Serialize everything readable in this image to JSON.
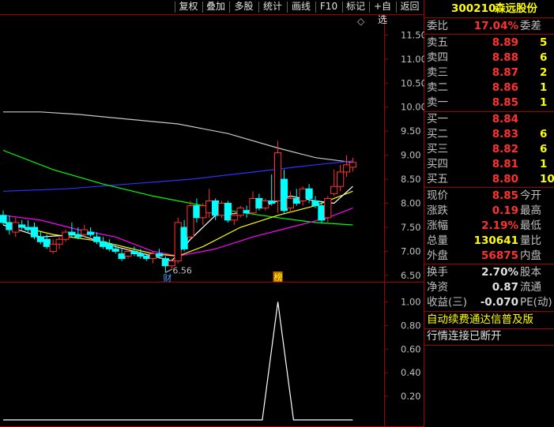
{
  "toolbar": {
    "items": [
      "复权",
      "叠加",
      "多股",
      "统计",
      "画线",
      "F10",
      "标记",
      "+自选",
      "返回"
    ]
  },
  "stock": {
    "code": "300210",
    "name": "森远股份"
  },
  "colors": {
    "up": "#ff3232",
    "down": "#00ffff",
    "ma5": "#ffffff",
    "ma10": "#ffff00",
    "ma20": "#ff00ff",
    "ma60": "#00ff00",
    "ma120": "#3030ff",
    "ma250": "#c8c8c8",
    "grid": "#a00000"
  },
  "order_book": {
    "wei_bi_label": "委比",
    "wei_bi_value": "17.04%",
    "wei_cha_label": "委差",
    "asks": [
      {
        "label": "卖五",
        "price": "8.89",
        "vol": "5"
      },
      {
        "label": "卖四",
        "price": "8.88",
        "vol": "6"
      },
      {
        "label": "卖三",
        "price": "8.87",
        "vol": "2"
      },
      {
        "label": "卖二",
        "price": "8.86",
        "vol": "1"
      },
      {
        "label": "卖一",
        "price": "8.85",
        "vol": "1"
      }
    ],
    "bids": [
      {
        "label": "买一",
        "price": "8.84",
        "vol": ""
      },
      {
        "label": "买二",
        "price": "8.83",
        "vol": "6"
      },
      {
        "label": "买三",
        "price": "8.82",
        "vol": "6"
      },
      {
        "label": "买四",
        "price": "8.81",
        "vol": "1"
      },
      {
        "label": "买五",
        "price": "8.80",
        "vol": "10"
      }
    ]
  },
  "quote": {
    "rows": [
      {
        "label": "现价",
        "value": "8.85",
        "label2": "今开"
      },
      {
        "label": "涨跌",
        "value": "0.19",
        "label2": "最高"
      },
      {
        "label": "涨幅",
        "value": "2.19%",
        "label2": "最低"
      },
      {
        "label": "总量",
        "value": "130641",
        "label2": "量比"
      },
      {
        "label": "外盘",
        "value": "56875",
        "label2": "内盘"
      }
    ]
  },
  "fundamentals": {
    "rows": [
      {
        "label": "换手",
        "value": "2.70%",
        "label2": "股本"
      },
      {
        "label": "净资",
        "value": "0.87",
        "label2": "流通"
      },
      {
        "label": "收益(三)",
        "value": "-0.070",
        "label2": "PE(动)"
      }
    ]
  },
  "messages": {
    "ad": "自动续费通达信普及版",
    "status": "行情连接已断开"
  },
  "chart_data": [
    {
      "type": "candlestick",
      "title": "",
      "y_ticks": [
        "11.50",
        "11.00",
        "10.50",
        "10.00",
        "9.50",
        "9.00",
        "8.50",
        "8.00",
        "7.50",
        "7.00",
        "6.50"
      ],
      "ylim": [
        6.4,
        11.9
      ],
      "annotations": [
        {
          "text": "6.56",
          "x_index": 26,
          "y": 6.56
        },
        {
          "text": "财",
          "x_index": 26
        },
        {
          "text": "榜",
          "x_index": 44
        }
      ],
      "diamond": "◇",
      "ohlc": [
        [
          7.75,
          7.85,
          7.55,
          7.6
        ],
        [
          7.6,
          7.75,
          7.35,
          7.45
        ],
        [
          7.4,
          7.7,
          7.3,
          7.6
        ],
        [
          7.55,
          7.65,
          7.45,
          7.5
        ],
        [
          7.5,
          7.65,
          7.4,
          7.45
        ],
        [
          7.5,
          7.6,
          7.25,
          7.3
        ],
        [
          7.3,
          7.4,
          7.15,
          7.2
        ],
        [
          7.25,
          7.35,
          7.05,
          7.1
        ],
        [
          7.0,
          7.25,
          6.95,
          7.15
        ],
        [
          7.15,
          7.3,
          7.05,
          7.25
        ],
        [
          7.25,
          7.45,
          7.2,
          7.4
        ],
        [
          7.4,
          7.6,
          7.3,
          7.35
        ],
        [
          7.35,
          7.5,
          7.25,
          7.3
        ],
        [
          7.35,
          7.55,
          7.3,
          7.45
        ],
        [
          7.4,
          7.5,
          7.3,
          7.35
        ],
        [
          7.3,
          7.4,
          7.15,
          7.2
        ],
        [
          7.2,
          7.3,
          7.05,
          7.1
        ],
        [
          7.15,
          7.25,
          7.0,
          7.05
        ],
        [
          7.05,
          7.15,
          6.95,
          7.0
        ],
        [
          6.95,
          7.05,
          6.8,
          6.85
        ],
        [
          6.9,
          7.05,
          6.85,
          7.0
        ],
        [
          7.0,
          7.1,
          6.9,
          6.95
        ],
        [
          6.95,
          7.05,
          6.85,
          6.9
        ],
        [
          6.9,
          6.95,
          6.8,
          6.85
        ],
        [
          6.85,
          7.0,
          6.75,
          6.95
        ],
        [
          6.95,
          7.05,
          6.85,
          6.9
        ],
        [
          6.85,
          6.9,
          6.56,
          6.7
        ],
        [
          6.7,
          6.85,
          6.62,
          6.8
        ],
        [
          6.8,
          7.7,
          6.75,
          7.6
        ],
        [
          7.5,
          7.65,
          7.0,
          7.05
        ],
        [
          7.3,
          8.05,
          7.25,
          7.95
        ],
        [
          7.95,
          8.1,
          7.6,
          7.7
        ],
        [
          7.7,
          8.0,
          7.55,
          7.95
        ],
        [
          7.8,
          8.3,
          7.7,
          8.05
        ],
        [
          8.05,
          8.1,
          7.65,
          7.75
        ],
        [
          7.75,
          8.05,
          7.7,
          8.0
        ],
        [
          8.0,
          8.05,
          7.6,
          7.65
        ],
        [
          7.65,
          7.8,
          7.55,
          7.75
        ],
        [
          7.75,
          7.95,
          7.7,
          7.9
        ],
        [
          7.85,
          7.95,
          7.7,
          7.8
        ],
        [
          7.8,
          8.25,
          7.75,
          8.1
        ],
        [
          8.1,
          8.2,
          7.85,
          7.9
        ],
        [
          7.9,
          8.1,
          7.85,
          8.05
        ],
        [
          8.05,
          8.6,
          7.95,
          8.0
        ],
        [
          8.05,
          9.3,
          7.8,
          9.05
        ],
        [
          8.5,
          8.7,
          7.8,
          7.85
        ],
        [
          7.9,
          8.25,
          7.8,
          8.1
        ],
        [
          8.1,
          8.3,
          7.95,
          8.0
        ],
        [
          8.05,
          8.35,
          7.95,
          8.3
        ],
        [
          8.3,
          8.4,
          8.0,
          8.1
        ],
        [
          8.05,
          8.15,
          7.9,
          7.95
        ],
        [
          7.95,
          8.05,
          7.6,
          7.65
        ],
        [
          7.7,
          8.15,
          7.6,
          8.1
        ],
        [
          8.2,
          8.7,
          8.15,
          8.35
        ],
        [
          8.35,
          8.8,
          8.25,
          8.65
        ],
        [
          8.65,
          9.0,
          8.55,
          8.8
        ],
        [
          8.75,
          8.95,
          8.66,
          8.85
        ]
      ],
      "ma_series": [
        {
          "key": "ma250",
          "values": [
            [
              0,
              9.9
            ],
            [
              6,
              9.9
            ],
            [
              12,
              9.85
            ],
            [
              20,
              9.75
            ],
            [
              28,
              9.65
            ],
            [
              36,
              9.45
            ],
            [
              44,
              9.15
            ],
            [
              50,
              8.95
            ],
            [
              56,
              8.85
            ]
          ]
        },
        {
          "key": "ma120",
          "values": [
            [
              0,
              8.25
            ],
            [
              10,
              8.3
            ],
            [
              20,
              8.4
            ],
            [
              30,
              8.5
            ],
            [
              40,
              8.65
            ],
            [
              50,
              8.8
            ],
            [
              56,
              8.88
            ]
          ]
        },
        {
          "key": "ma60",
          "values": [
            [
              0,
              9.1
            ],
            [
              8,
              8.7
            ],
            [
              16,
              8.4
            ],
            [
              24,
              8.15
            ],
            [
              30,
              8.0
            ],
            [
              36,
              7.85
            ],
            [
              44,
              7.7
            ],
            [
              50,
              7.6
            ],
            [
              56,
              7.55
            ]
          ]
        },
        {
          "key": "ma20",
          "values": [
            [
              0,
              7.75
            ],
            [
              6,
              7.65
            ],
            [
              12,
              7.45
            ],
            [
              18,
              7.3
            ],
            [
              24,
              7.0
            ],
            [
              28,
              6.9
            ],
            [
              34,
              7.05
            ],
            [
              40,
              7.3
            ],
            [
              46,
              7.5
            ],
            [
              52,
              7.7
            ],
            [
              56,
              7.9
            ]
          ]
        },
        {
          "key": "ma10",
          "values": [
            [
              0,
              7.6
            ],
            [
              8,
              7.35
            ],
            [
              16,
              7.2
            ],
            [
              24,
              6.95
            ],
            [
              28,
              6.9
            ],
            [
              32,
              7.1
            ],
            [
              38,
              7.5
            ],
            [
              44,
              7.75
            ],
            [
              50,
              7.95
            ],
            [
              56,
              8.25
            ]
          ]
        },
        {
          "key": "ma5",
          "values": [
            [
              0,
              7.55
            ],
            [
              6,
              7.3
            ],
            [
              12,
              7.35
            ],
            [
              18,
              7.1
            ],
            [
              24,
              6.9
            ],
            [
              27,
              6.8
            ],
            [
              30,
              7.25
            ],
            [
              34,
              7.75
            ],
            [
              38,
              7.8
            ],
            [
              42,
              7.95
            ],
            [
              46,
              8.15
            ],
            [
              50,
              8.05
            ],
            [
              53,
              8.0
            ],
            [
              56,
              8.35
            ]
          ]
        }
      ]
    },
    {
      "type": "line",
      "title": "",
      "y_ticks": [
        "1.00",
        "0.80",
        "0.60",
        "0.40",
        "0.20"
      ],
      "ylim": [
        -0.02,
        1.15
      ],
      "values": [
        [
          0,
          0
        ],
        [
          43,
          0
        ],
        [
          44,
          1
        ],
        [
          45,
          0
        ],
        [
          56,
          0
        ]
      ]
    }
  ]
}
